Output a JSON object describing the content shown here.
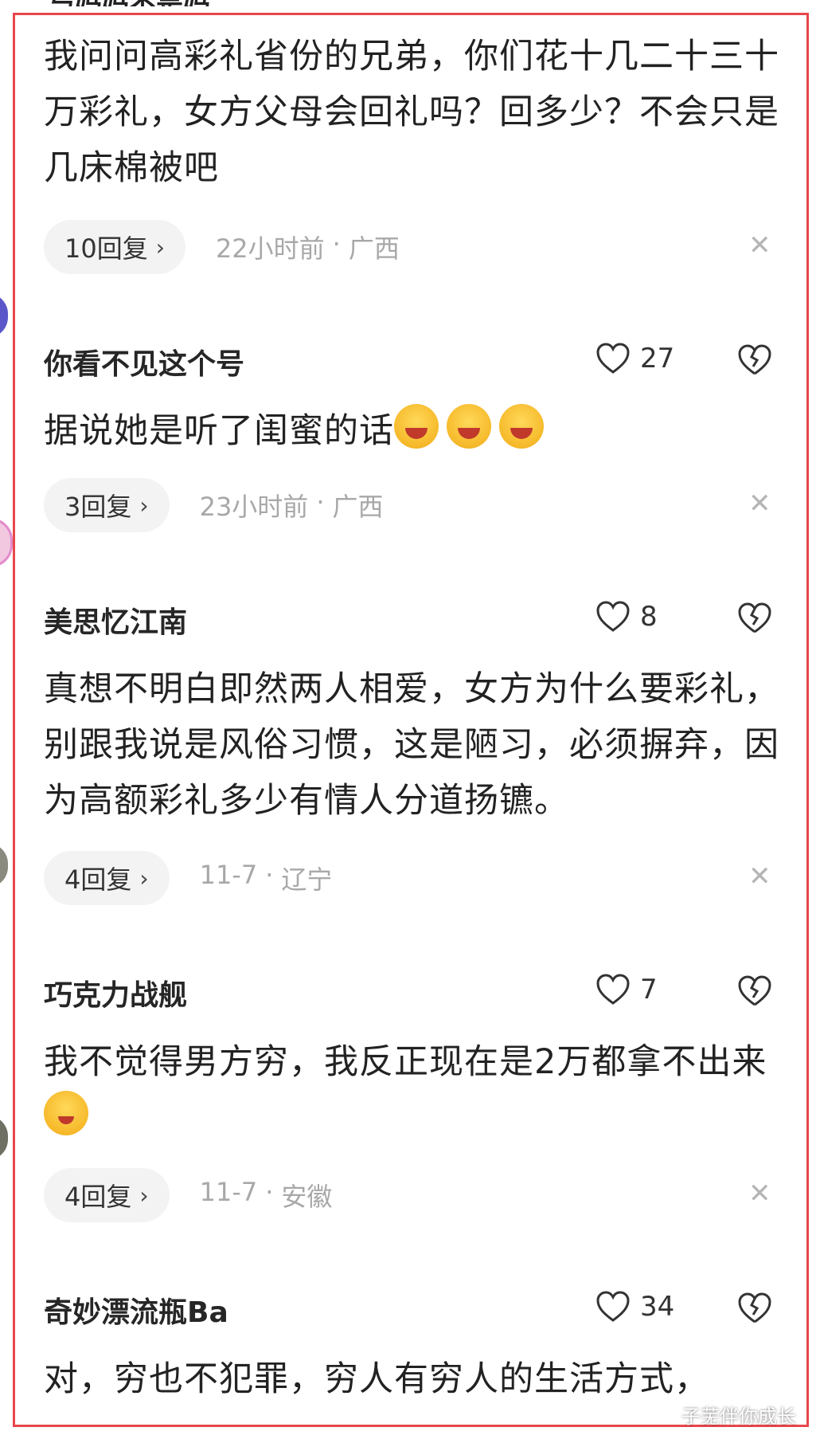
{
  "top_partial": {
    "username": "与妈妈不是妈"
  },
  "comments": [
    {
      "username": "",
      "likes": "",
      "text": "我问问高彩礼省份的兄弟，你们花十几二十三十万彩礼，女方父母会回礼吗？回多少？不会只是几床棉被吧",
      "reply_label": "10回复",
      "time": "22小时前",
      "location": "广西"
    },
    {
      "username": "你看不见这个号",
      "likes": "27",
      "text": "据说她是听了闺蜜的话",
      "emoji_count": 3,
      "reply_label": "3回复",
      "time": "23小时前",
      "location": "广西"
    },
    {
      "username": "美思忆江南",
      "likes": "8",
      "text": "真想不明白即然两人相爱，女方为什么要彩礼，别跟我说是风俗习惯，这是陋习，必须摒弃，因为高额彩礼多少有情人分道扬镳。",
      "reply_label": "4回复",
      "time": "11-7",
      "location": "辽宁"
    },
    {
      "username": "巧克力战舰",
      "likes": "7",
      "text_before": "我不觉得男方穷，我反正现在是2万都拿不出来",
      "reply_label": "4回复",
      "time": "11-7",
      "location": "安徽"
    },
    {
      "username": "奇妙漂流瓶Ba",
      "likes": "34",
      "text": "对，穷也不犯罪，穷人有穷人的生活方式，"
    }
  ],
  "separator": "·",
  "close_glyph": "✕",
  "chevron_glyph": "›",
  "watermark": "子芜伴你成长",
  "colors": {
    "frame": "#e8474b",
    "meta_text": "#a8a8a8",
    "pill_bg": "#f3f3f3"
  }
}
